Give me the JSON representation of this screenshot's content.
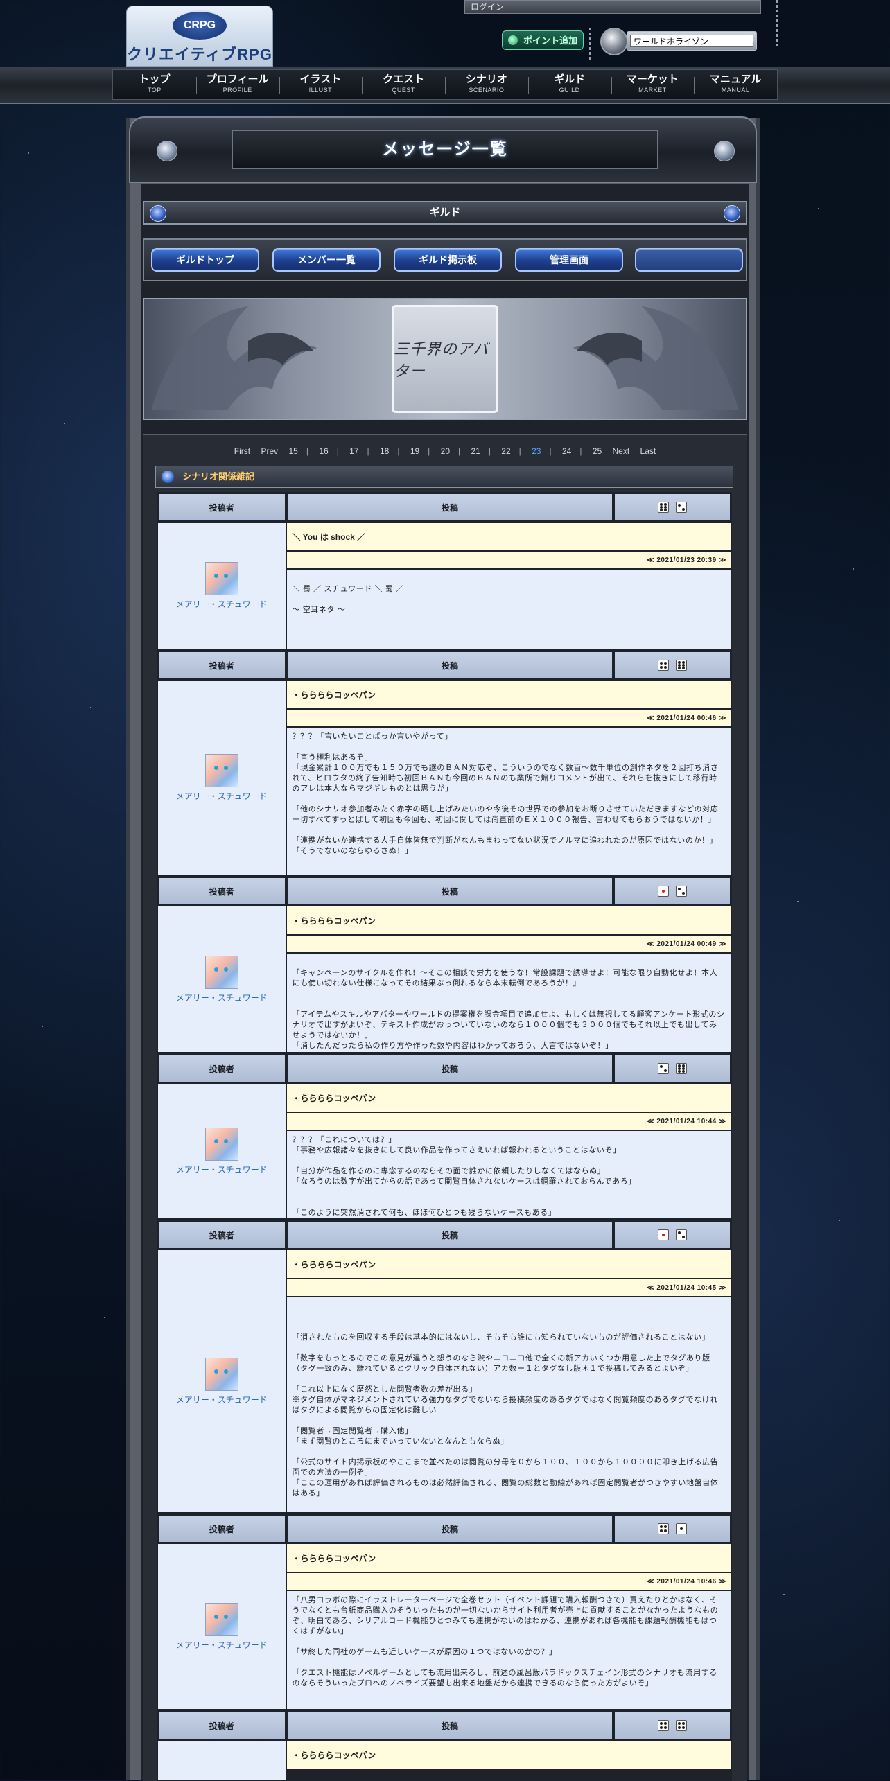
{
  "header": {
    "logo_badge": "CRPG",
    "logo_text": "クリエイティブRPG",
    "login_label": "ログイン",
    "point_button": "ポイント追加",
    "world_value": "ワールドホライゾン"
  },
  "nav": [
    {
      "jp": "トップ",
      "en": "TOP"
    },
    {
      "jp": "プロフィール",
      "en": "PROFILE"
    },
    {
      "jp": "イラスト",
      "en": "ILLUST"
    },
    {
      "jp": "クエスト",
      "en": "QUEST"
    },
    {
      "jp": "シナリオ",
      "en": "SCENARIO"
    },
    {
      "jp": "ギルド",
      "en": "GUILD"
    },
    {
      "jp": "マーケット",
      "en": "MARKET"
    },
    {
      "jp": "マニュアル",
      "en": "MANUAL"
    }
  ],
  "page_title": "メッセージ一覧",
  "guild": {
    "header": "ギルド",
    "tabs": [
      "ギルドトップ",
      "メンバー一覧",
      "ギルド掲示板",
      "管理画面",
      ""
    ],
    "banner_logo": "三千界のアバター"
  },
  "pager": {
    "first": "First",
    "prev": "Prev",
    "pages": [
      "15",
      "16",
      "17",
      "18",
      "19",
      "20",
      "21",
      "22",
      "23",
      "24",
      "25"
    ],
    "current": "23",
    "next": "Next",
    "last": "Last"
  },
  "category": "シナリオ関係雑記",
  "table_headers": {
    "author": "投稿者",
    "post": "投稿"
  },
  "posts": [
    {
      "author": "メアリー・スチュワード",
      "subject": "＼ You は shock ／",
      "date": "≪ 2021/01/23 20:39 ≫",
      "body": "\n＼ 蜀 ／ スチュワード ＼ 蜀 ／\n\n〜 空耳ネタ 〜"
    },
    {
      "author": "メアリー・スチュワード",
      "subject": "・ららららコッペパン",
      "date": "≪ 2021/01/24 00:46 ≫",
      "body": "？？？「言いたいことばっか言いやがって」\n\n「言う権利はあるぞ」\n「現金累計１００万でも１５０万でも謎のＢＡＮ対応ぞ、こういうのでなく数百〜数千単位の創作ネタを２回打ち消されて、ヒロウタの終了告知時も初回ＢＡＮも今回のＢＡＮのも業所で煽りコメントが出て、それらを抜きにして移行時のアレは本人ならマジギレものとは思うが」\n\n「他のシナリオ参加者みたく赤字の晒し上げみたいのや今後その世界での参加をお断りさせていただきますなどの対応一切すべてすっとばして初回も今回も、初回に関しては尚直前のＥＸ１０００報告、言わせてもらおうではないか！」\n\n「連携がないか連携する人手自体皆無で判断がなんもまわってない状況でノルマに追われたのが原因ではないのか！」\n「そうでないのならゆるさぬ！」"
    },
    {
      "author": "メアリー・スチュワード",
      "subject": "・ららららコッペパン",
      "date": "≪ 2021/01/24 00:49 ≫",
      "body": "\n「キャンペーンのサイクルを作れ！〜そこの相談で労力を使うな！常設課題で誘導せよ！可能な限り自動化せよ！本人にも使い切れない仕様になってその結果ぶっ倒れるなら本末転倒であろうが！」\n\n\n「アイテムやスキルやアバターやワールドの提案権を課金項目で追加せよ、もしくは無視してる顧客アンケート形式のシナリオで出すがよいぞ、テキスト作成がおっついていないのなら１０００個でも３０００個でもそれ以上でも出してみせようではないか！」\n「消したんだったら私の作り方や作った数や内容はわかっておろう、大言ではないぞ！」"
    },
    {
      "author": "メアリー・スチュワード",
      "subject": "・ららららコッペパン",
      "date": "≪ 2021/01/24 10:44 ≫",
      "body": "？？？「これについては？」\n「事務や広報諸々を抜きにして良い作品を作ってさえいれば報われるということはないぞ」\n\n「自分が作品を作るのに専念するのならその面で誰かに依頼したりしなくてはならぬ」\n「なろうのは数字が出てからの話であって閲覧自体されないケースは網羅されておらんであろ」\n\n\n「このように突然消されて何も、ほぼ何ひとつも残らないケースもある」"
    },
    {
      "author": "メアリー・スチュワード",
      "subject": "・ららららコッペパン",
      "date": "≪ 2021/01/24 10:45 ≫",
      "body": "\n\n\n「消されたものを回収する手段は基本的にはないし、そもそも誰にも知られていないものが評価されることはない」\n\n「数字をもっとるのでこの意見が違うと想うのなら渋やニコニコ他で全くの新アカいくつか用意した上でタグあり版（タグ一致のみ、離れているとクリック自体されない）アカ数ー１とタグなし版＊１で投稿してみるとよいぞ」\n\n「これ以上になく歴然とした閲覧者数の差が出る」\n※タグ自体がマネジメントされている強力なタグでないなら投稿頻度のあるタグではなく閲覧頻度のあるタグでなければタグによる閲覧からの固定化は難しい\n\n「閲覧者→固定閲覧者→購入他」\n「まず閲覧のところにまでいっていないとなんともならぬ」\n\n「公式のサイト内掲示板のやここまで並べたのは閲覧の分母を０から１００、１００から１００００に叩き上げる広告面での方法の一例ぞ」\n「ここの運用があれば評価されるものは必然評価される、閲覧の総数と動線があれば固定閲覧者がつきやすい地盤自体はある」"
    },
    {
      "author": "メアリー・スチュワード",
      "subject": "・ららららコッペパン",
      "date": "≪ 2021/01/24 10:46 ≫",
      "body": "「八男コラボの際にイラストレーターページで全巻セット（イベント課題で購入報酬つきで）買えたりとかはなく、そうでなくとも台紙商品購入のそういったものが一切ないからサイト利用者が売上に貢献することがなかったようなものぞ、明白であろ、シリアルコード機能ひとつみても連携がないのはわかる、連携があれば各機能も課題報酬機能もはつくはずがない」\n\n「サ終した同社のゲームも近しいケースが原因の１つではないのかの？」\n\n「クエスト機能はノベルゲームとしても流用出来るし、前述の風呂版パラドックスチェイン形式のシナリオも流用するのならそういったプロへのノベライズ要望も出来る地盤だから連携できるのなら使った方がよいぞ」"
    },
    {
      "author": "",
      "subject": "・ららららコッペパン",
      "date": "",
      "body": ""
    }
  ],
  "colors": {
    "accent_blue": "#2f6bb5",
    "current_page": "#5da7ff",
    "category_text": "#ffcf6b",
    "subject_bg": "#fffbdc",
    "body_bg": "#e6eefc"
  }
}
